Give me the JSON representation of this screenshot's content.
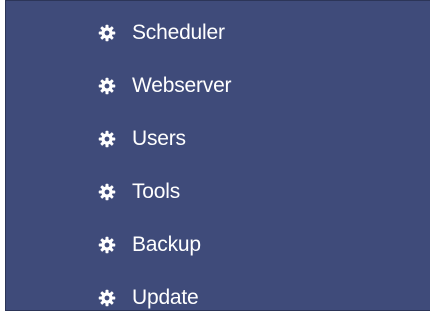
{
  "menu": {
    "background_color": "#3f4b7a",
    "text_color": "#ffffff",
    "items": [
      {
        "label": "Scheduler",
        "icon": "gear-icon"
      },
      {
        "label": "Webserver",
        "icon": "gear-icon"
      },
      {
        "label": "Users",
        "icon": "gear-icon"
      },
      {
        "label": "Tools",
        "icon": "gear-icon"
      },
      {
        "label": "Backup",
        "icon": "gear-icon"
      },
      {
        "label": "Update",
        "icon": "gear-icon"
      }
    ]
  }
}
